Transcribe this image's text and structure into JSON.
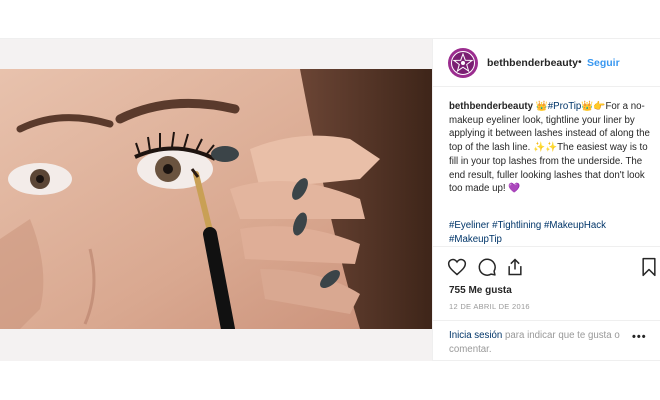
{
  "post": {
    "username": "bethbenderbeauty",
    "separator": "•",
    "follow_label": "Seguir",
    "caption_user": "bethbenderbeauty",
    "caption_emoji_1": "👑",
    "caption_hashtag": "#ProTip",
    "caption_emoji_2": "👑👉",
    "caption_text_1": "For a no-makeup eyeliner look, tightline your liner by applying it between lashes instead of along the top of the lash line. ",
    "caption_emoji_3": "✨✨",
    "caption_text_2": "The easiest way is to fill in your top lashes from the underside. The end result, fuller looking lashes that don't look too made up! ",
    "caption_emoji_4": "💜",
    "hashtags": [
      "#Eyeliner",
      "#Tightlining",
      "#MakeupHack",
      "#MakeupTip"
    ],
    "likes": "755 Me gusta",
    "date": "12 DE ABRIL DE 2016",
    "login_link": "Inicia sesión",
    "login_text": " para indicar que te gusta o comentar.",
    "more_label": "•••"
  },
  "icons": {
    "like": "heart-icon",
    "comment": "comment-icon",
    "share": "share-icon",
    "save": "bookmark-icon",
    "avatar_logo": "star-logo-icon"
  },
  "colors": {
    "link_blue": "#3897f0",
    "hashtag_blue": "#003569",
    "avatar_purple": "#9b2d8f",
    "muted_gray": "#999999"
  }
}
